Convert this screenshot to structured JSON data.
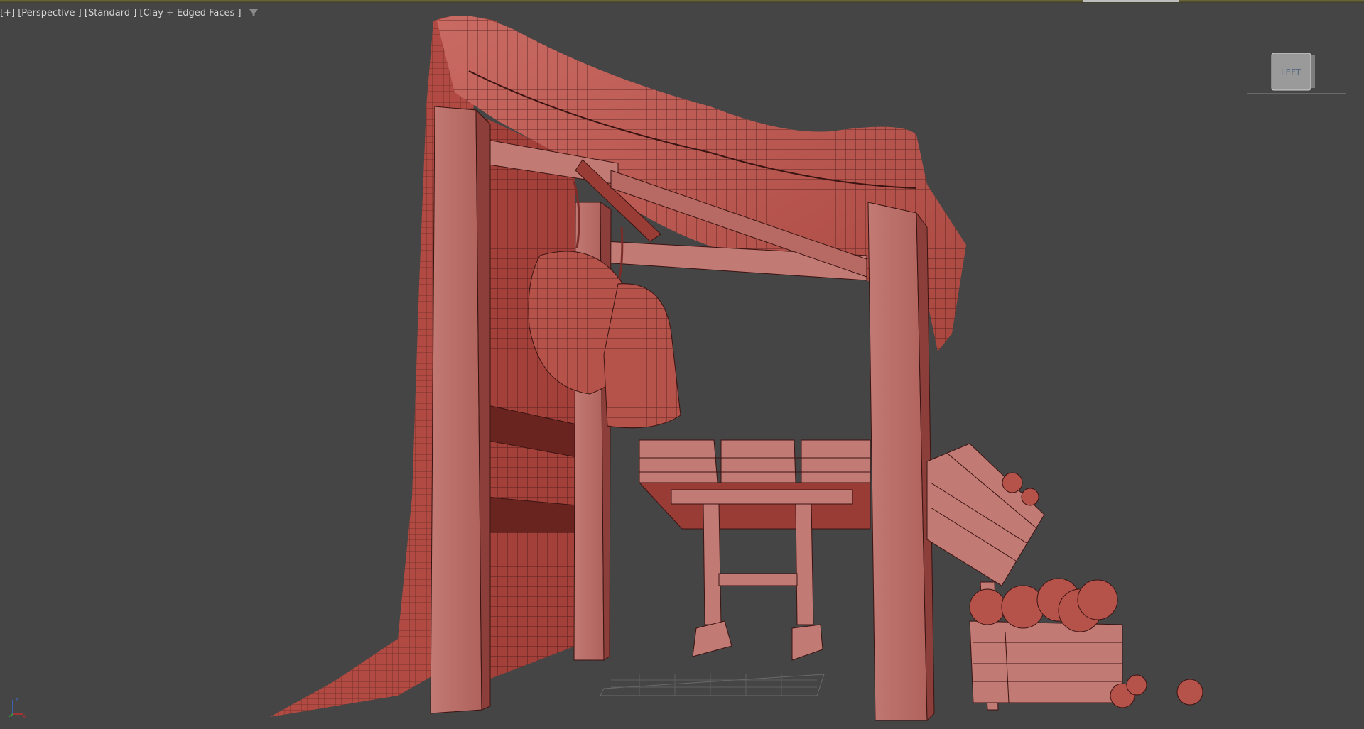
{
  "viewport": {
    "labels": {
      "menu": "[+]",
      "view": "[Perspective ]",
      "shading_mode": "[Standard ]",
      "display_mode": "[Clay + Edged Faces ]"
    },
    "viewcube_face": "LEFT",
    "axis": {
      "x": "x",
      "y": "y",
      "z": "z"
    },
    "colors": {
      "background": "#454545",
      "model": "#c0605a",
      "model_dark": "#8a3430",
      "wire": "#3a1412"
    },
    "icons": [
      "filter-icon",
      "viewcube-icon",
      "axis-tripod-icon"
    ]
  }
}
